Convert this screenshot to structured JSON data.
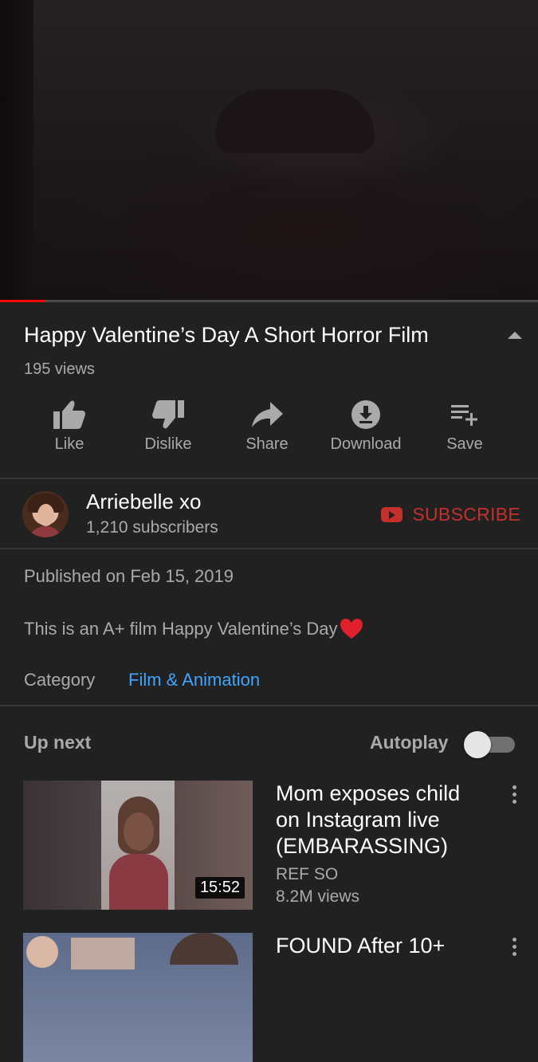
{
  "player": {
    "progress_fraction": 0.085
  },
  "video": {
    "title": "Happy Valentine’s Day A Short Horror Film",
    "views": "195 views"
  },
  "actions": [
    {
      "label": "Like",
      "icon": "thumbs-up-icon"
    },
    {
      "label": "Dislike",
      "icon": "thumbs-down-icon"
    },
    {
      "label": "Share",
      "icon": "share-arrow-icon"
    },
    {
      "label": "Download",
      "icon": "download-icon"
    },
    {
      "label": "Save",
      "icon": "playlist-add-icon"
    }
  ],
  "channel": {
    "name": "Arriebelle xo",
    "subscribers": "1,210 subscribers",
    "subscribe_label": "SUBSCRIBE"
  },
  "details": {
    "published": "Published on Feb 15, 2019",
    "description": "This is an A+ film Happy Valentine’s Day",
    "description_emoji": "heart-icon",
    "category_label": "Category",
    "category_value": "Film & Animation"
  },
  "upnext": {
    "label": "Up next",
    "autoplay_label": "Autoplay",
    "autoplay_on": false
  },
  "recommendations": [
    {
      "title": "Mom exposes child on Instagram live (EMBARASSING)",
      "channel": "REF SO",
      "views": "8.2M views",
      "duration": "15:52"
    },
    {
      "title": "FOUND After 10+"
    }
  ],
  "colors": {
    "background": "#212121",
    "progress": "#ff0000",
    "subscribe": "#c4302b",
    "link": "#3ea6ff",
    "secondary_text": "#aaaaaa"
  }
}
